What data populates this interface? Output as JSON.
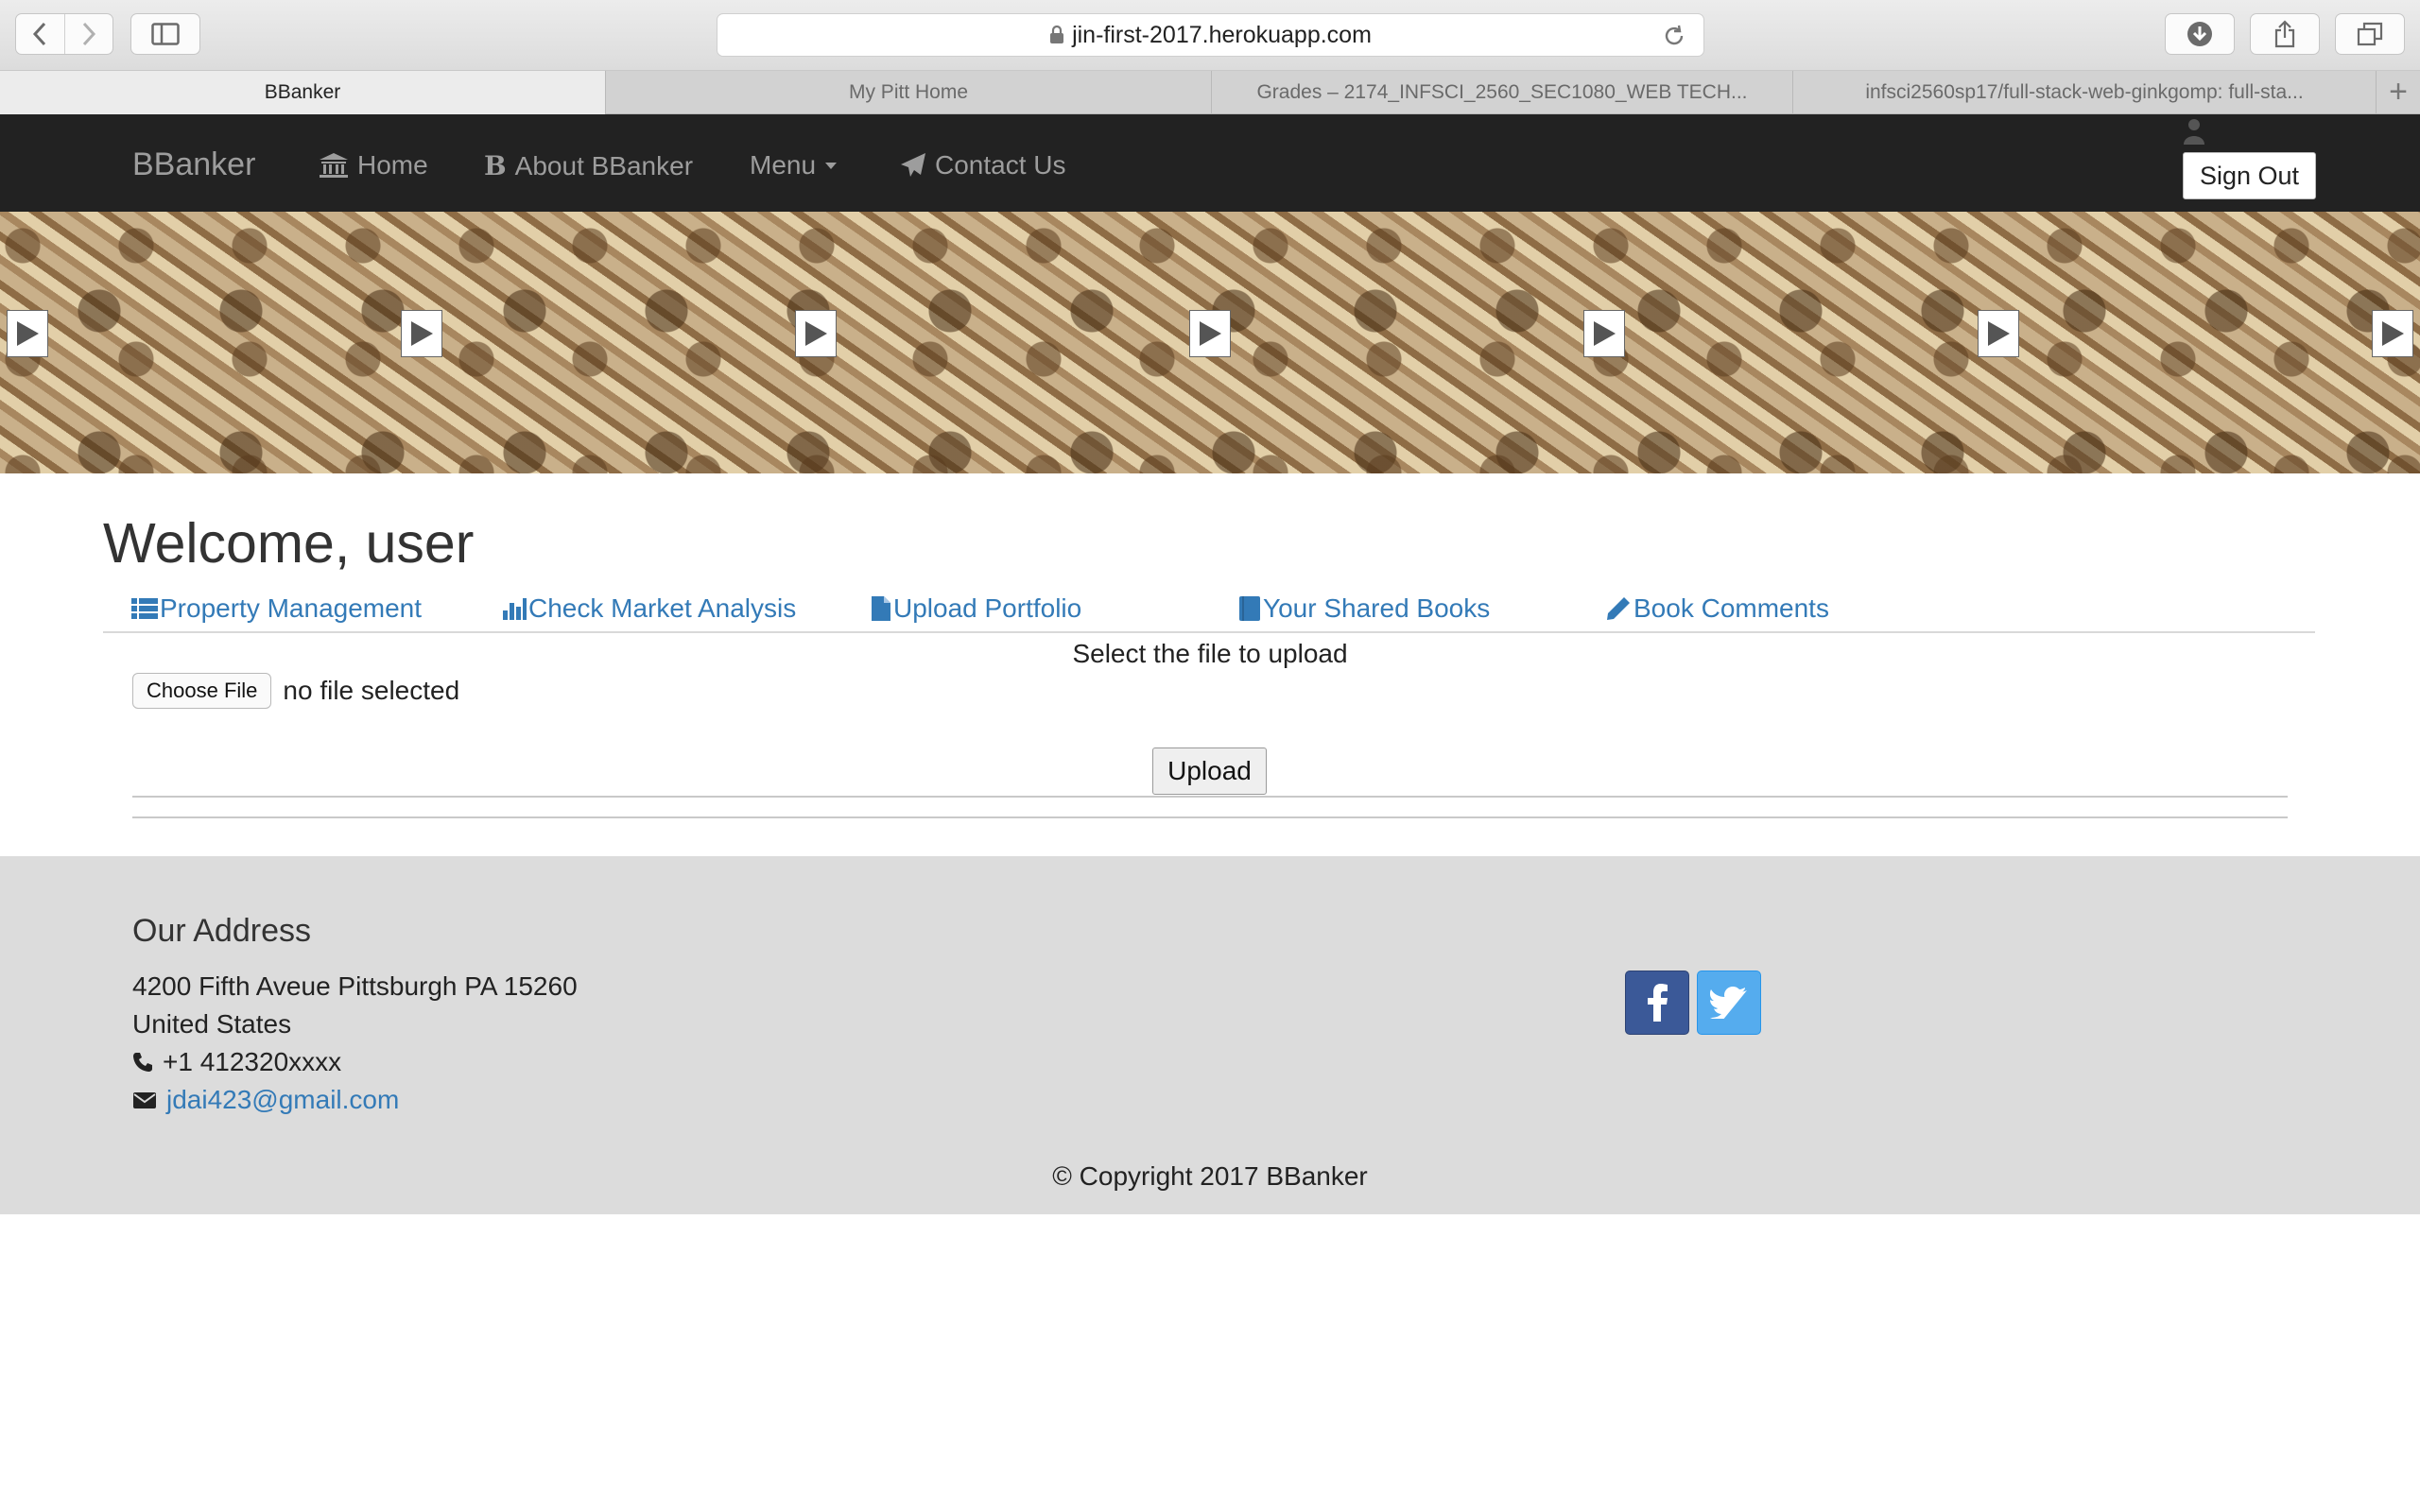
{
  "browser": {
    "url": "jin-first-2017.herokuapp.com",
    "tabs": [
      {
        "label": "BBanker",
        "active": true
      },
      {
        "label": "My Pitt Home",
        "active": false
      },
      {
        "label": "Grades – 2174_INFSCI_2560_SEC1080_WEB TECH...",
        "active": false
      },
      {
        "label": "infsci2560sp17/full-stack-web-ginkgomp: full-sta...",
        "active": false
      }
    ]
  },
  "navbar": {
    "brand": "BBanker",
    "home": "Home",
    "about": "About BBanker",
    "about_glyph": "B",
    "menu": "Menu",
    "contact": "Contact Us",
    "sign_out": "Sign Out"
  },
  "main": {
    "welcome": "Welcome, user",
    "tabs": {
      "property": "Property Management",
      "market": "Check Market Analysis",
      "upload": "Upload Portfolio",
      "books": "Your Shared Books",
      "comments": "Book Comments"
    },
    "upload_label": "Select the file to upload",
    "choose_file": "Choose File",
    "file_status": "no file selected",
    "upload_button": "Upload"
  },
  "footer": {
    "title": "Our Address",
    "street": "4200 Fifth Aveue Pittsburgh PA 15260",
    "country": "United States",
    "phone": "+1 412320xxxx",
    "email": "jdai423@gmail.com",
    "copyright": "© Copyright 2017 BBanker"
  },
  "colors": {
    "navbar_bg": "#222222",
    "link": "#337ab7",
    "footer_bg": "#dcdcdc",
    "facebook": "#3b5998",
    "twitter": "#55acee"
  }
}
